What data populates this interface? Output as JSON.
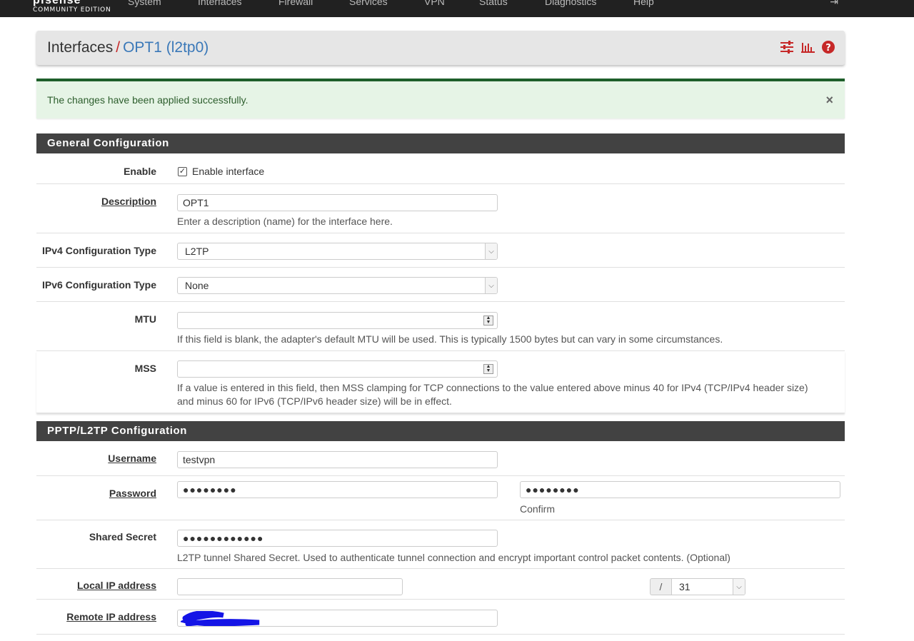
{
  "topnav": {
    "logo_mark": "pfsense",
    "edition": "COMMUNITY EDITION",
    "items": [
      "System",
      "Interfaces",
      "Firewall",
      "Services",
      "VPN",
      "Status",
      "Diagnostics",
      "Help"
    ]
  },
  "breadcrumb": {
    "parent": "Interfaces",
    "separator": "/",
    "current": "OPT1 (l2tp0)",
    "icons": [
      "sliders-icon",
      "bar-chart-icon",
      "help-icon"
    ]
  },
  "alert": {
    "message": "The changes have been applied successfully.",
    "close": "×"
  },
  "general": {
    "title": "General Configuration",
    "enable_label": "Enable",
    "enable_text": "Enable interface",
    "enable_checked": true,
    "description_label": "Description",
    "description_value": "OPT1",
    "description_help": "Enter a description (name) for the interface here.",
    "ipv4_label": "IPv4 Configuration Type",
    "ipv4_value": "L2TP",
    "ipv6_label": "IPv6 Configuration Type",
    "ipv6_value": "None",
    "mtu_label": "MTU",
    "mtu_value": "",
    "mtu_help": "If this field is blank, the adapter's default MTU will be used. This is typically 1500 bytes but can vary in some circumstances.",
    "mss_label": "MSS",
    "mss_value": "",
    "mss_help": "If a value is entered in this field, then MSS clamping for TCP connections to the value entered above minus 40 for IPv4 (TCP/IPv4 header size) and minus 60 for IPv6 (TCP/IPv6 header size) will be in effect."
  },
  "pptp": {
    "title": "PPTP/L2TP Configuration",
    "username_label": "Username",
    "username_value": "testvpn",
    "password_label": "Password",
    "password_value": "●●●●●●●●",
    "confirm_value": "●●●●●●●●",
    "confirm_help": "Confirm",
    "secret_label": "Shared Secret",
    "secret_value": "●●●●●●●●●●●●",
    "secret_help": "L2TP tunnel Shared Secret. Used to authenticate tunnel connection and encrypt important control packet contents. (Optional)",
    "local_ip_label": "Local IP address",
    "local_ip_value": "",
    "slash": "/",
    "subnet_value": "31",
    "remote_ip_label": "Remote IP address"
  }
}
